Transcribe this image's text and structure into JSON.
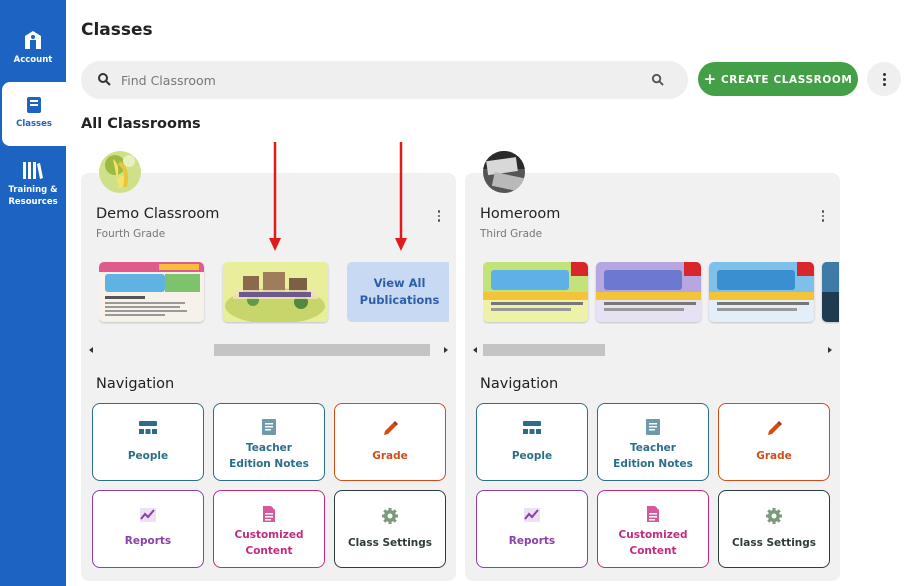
{
  "sidebar": {
    "items": [
      {
        "label": "Account",
        "icon": "account-icon"
      },
      {
        "label": "Classes",
        "icon": "classes-icon",
        "active": true
      },
      {
        "label": "Training & Resources",
        "icon": "books-icon"
      }
    ]
  },
  "page": {
    "title": "Classes",
    "search_placeholder": "Find Classroom",
    "create_button": "CREATE CLASSROOM",
    "section_title": "All Classrooms"
  },
  "colors": {
    "sidebar": "#1d63c1",
    "create_button": "#43a047",
    "people": "#2a6f8a",
    "teacher_notes": "#2a6f8a",
    "grade": "#d24c1a",
    "reports": "#8b3fa8",
    "customized": "#c22b7c",
    "settings": "#2f3b3b"
  },
  "classrooms": [
    {
      "name": "Demo Classroom",
      "grade": "Fourth Grade",
      "view_all": "View All Publications",
      "nav_title": "Navigation",
      "nav": [
        "People",
        "Teacher Edition Notes",
        "Grade",
        "Reports",
        "Customized Content",
        "Class Settings"
      ]
    },
    {
      "name": "Homeroom",
      "grade": "Third Grade",
      "nav_title": "Navigation",
      "nav": [
        "People",
        "Teacher Edition Notes",
        "Grade",
        "Reports",
        "Customized Content",
        "Class Settings"
      ]
    }
  ]
}
